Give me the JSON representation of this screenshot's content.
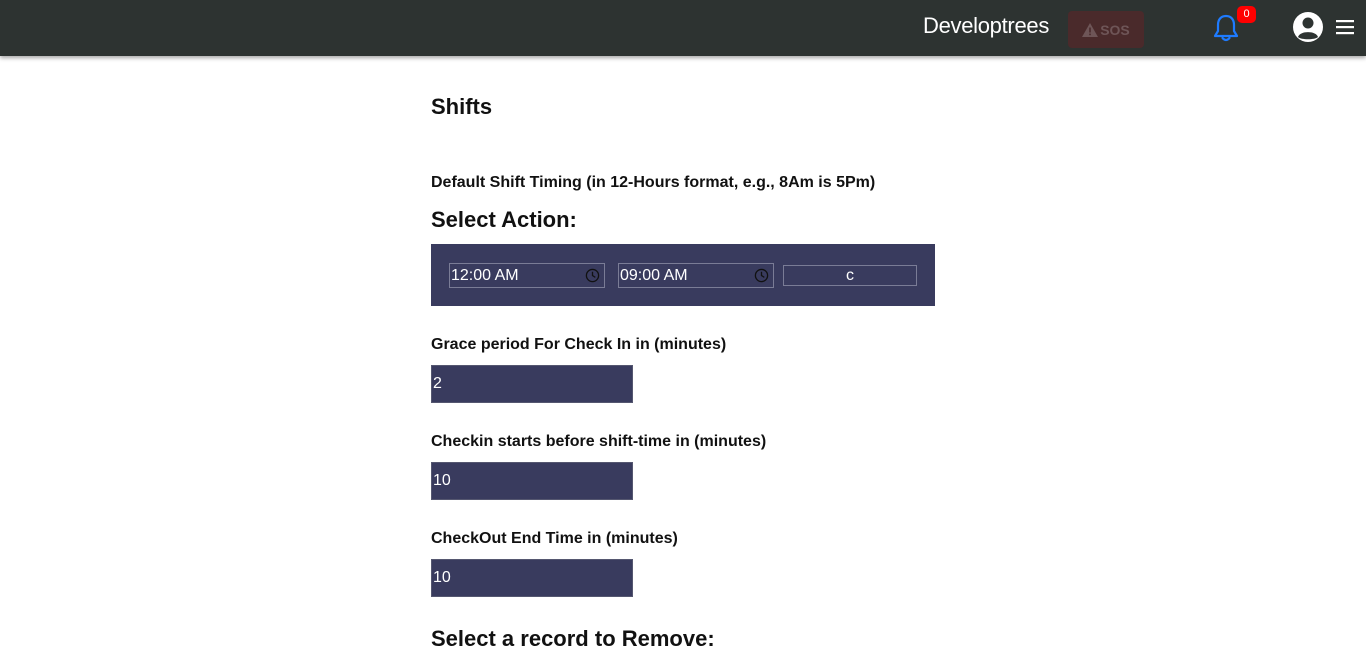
{
  "header": {
    "brand": "Developtrees",
    "sos_label": "SOS",
    "notification_count": "0",
    "accent_colors": {
      "bar": "#2d3331",
      "bell": "#1e7bff",
      "badge": "#ff0000",
      "sos_bg": "#4a2a2b"
    }
  },
  "page": {
    "title": "Shifts",
    "default_shift_label": "Default Shift Timing (in 12-Hours format, e.g., 8Am is 5Pm)",
    "select_action_title": "Select Action:",
    "shift_start": "12:00 AM",
    "shift_end": "09:00 AM",
    "shift_code": "c",
    "grace_label": "Grace period For Check In in (minutes)",
    "grace_value": "2",
    "checkin_label": "Checkin starts before shift-time in (minutes)",
    "checkin_value": "10",
    "checkout_label": "CheckOut End Time in (minutes)",
    "checkout_value": "10",
    "remove_title": "Select a record to Remove:",
    "panel_color": "#393b5e"
  }
}
